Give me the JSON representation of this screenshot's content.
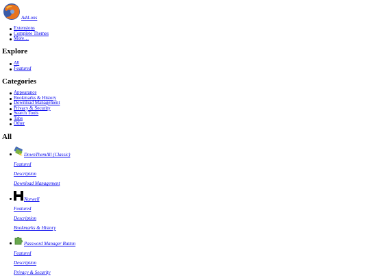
{
  "header": {
    "addons_label": "Add-ons"
  },
  "nav": {
    "items": [
      "Extensions",
      "Complete Themes",
      "More…"
    ]
  },
  "explore": {
    "heading": "Explore",
    "items": [
      "All",
      "Featured"
    ]
  },
  "categories": {
    "heading": "Categories",
    "items": [
      "Appearance",
      "Bookmarks & History",
      "Download Management",
      "Privacy & Security",
      "Search Tools",
      "Tabs",
      "Other"
    ]
  },
  "all": {
    "heading": "All",
    "addons": [
      {
        "name": "DownThemAll (Classic)",
        "featured": "Featured",
        "description": "Description",
        "category": "Download Management"
      },
      {
        "name": "Norwell",
        "featured": "Featured",
        "description": "Description",
        "category": "Bookmarks & History"
      },
      {
        "name": "Password Manager Button",
        "featured": "Featured",
        "description": "Description",
        "category": "Privacy & Security"
      }
    ]
  },
  "colors": {
    "link": "#0000ee",
    "text": "#000000",
    "background": "#ffffff"
  }
}
